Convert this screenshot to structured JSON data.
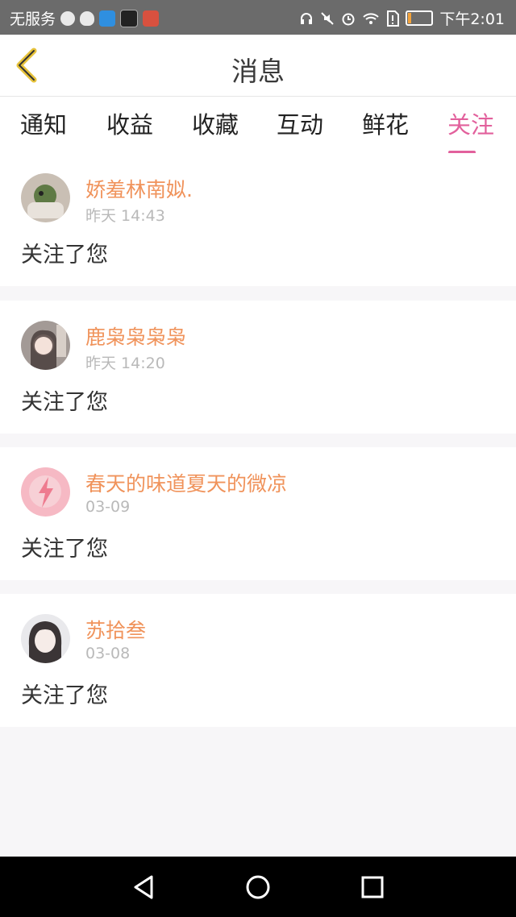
{
  "status_bar": {
    "carrier": "无服务",
    "time": "下午2:01",
    "icons_left": [
      "globe-icon",
      "qq-icon",
      "shield-app-icon",
      "game-app-icon",
      "cake-app-icon"
    ],
    "icons_right": [
      "headset-icon",
      "mute-icon",
      "alarm-icon",
      "wifi-icon",
      "sim-alert-icon",
      "battery-icon"
    ],
    "battery_level": 0.15,
    "battery_color": "#f3a33b"
  },
  "header": {
    "title": "消息",
    "back_color": "#e6c23a"
  },
  "tabs": [
    {
      "label": "通知",
      "active": false
    },
    {
      "label": "收益",
      "active": false
    },
    {
      "label": "收藏",
      "active": false
    },
    {
      "label": "互动",
      "active": false
    },
    {
      "label": "鲜花",
      "active": false
    },
    {
      "label": "关注",
      "active": true
    }
  ],
  "accent_color": "#e2609c",
  "name_color": "#f0935b",
  "follows": [
    {
      "name": "娇羞林南姒.",
      "time": "昨天 14:43",
      "message": "关注了您"
    },
    {
      "name": "鹿枭枭枭枭",
      "time": "昨天 14:20",
      "message": "关注了您"
    },
    {
      "name": "春天的味道夏天的微凉",
      "time": "03-09",
      "message": "关注了您"
    },
    {
      "name": "苏拾叁",
      "time": "03-08",
      "message": "关注了您"
    }
  ]
}
